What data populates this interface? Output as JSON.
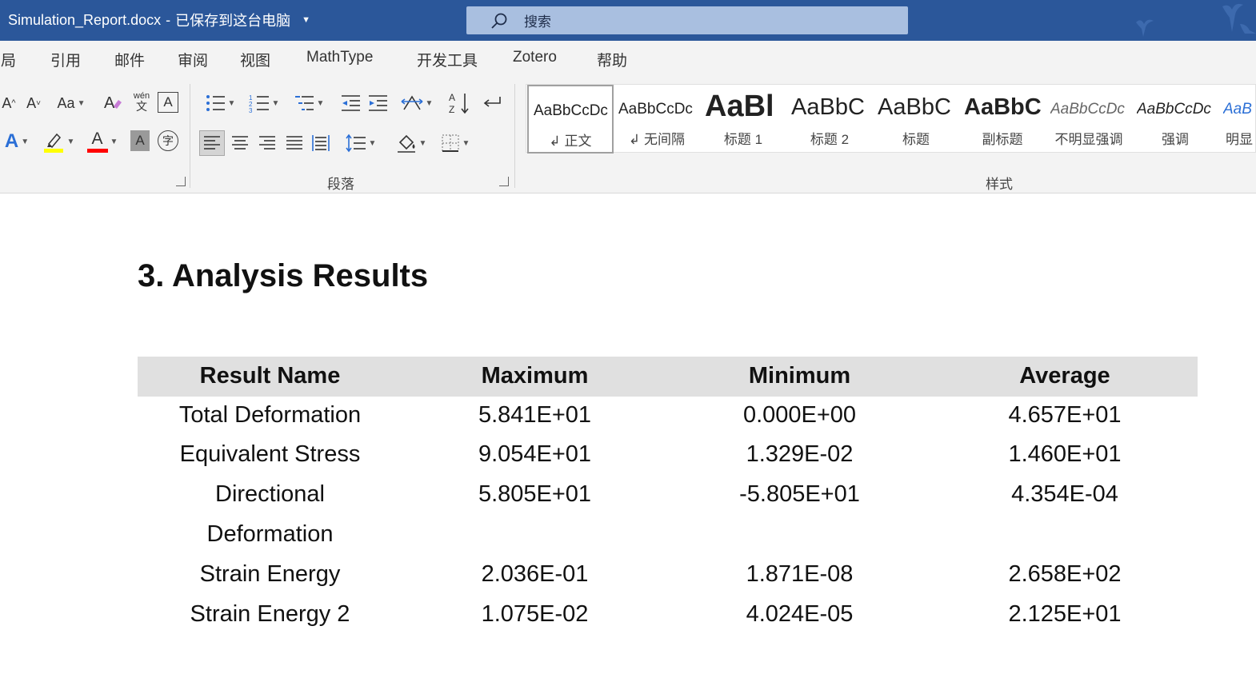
{
  "titlebar": {
    "document_name": "Simulation_Report.docx",
    "separator": "-",
    "save_status": "已保存到这台电脑",
    "search_placeholder": "搜索"
  },
  "menu": {
    "tabs": [
      "布局",
      "引用",
      "邮件",
      "审阅",
      "视图",
      "MathType",
      "开发工具",
      "Zotero",
      "帮助"
    ]
  },
  "ribbon": {
    "paragraph_group_label": "段落",
    "styles_group_label": "样式",
    "styles": [
      {
        "sample": "AaBbCcDc",
        "name": "↲ 正文"
      },
      {
        "sample": "AaBbCcDc",
        "name": "↲ 无间隔"
      },
      {
        "sample": "AaBl",
        "name": "标题 1"
      },
      {
        "sample": "AaBbC",
        "name": "标题 2"
      },
      {
        "sample": "AaBbC",
        "name": "标题"
      },
      {
        "sample": "AaBbC",
        "name": "副标题"
      },
      {
        "sample": "AaBbCcDc",
        "name": "不明显强调"
      },
      {
        "sample": "AaBbCcDc",
        "name": "强调"
      },
      {
        "sample": "AaB",
        "name": "明显"
      }
    ],
    "font_buttons": {
      "change_case": "Aa",
      "phonetic_top": "wén",
      "phonetic_bottom": "文",
      "char_border": "A",
      "text_effect": "A",
      "font_color": "A",
      "char_shading": "A",
      "enclose": "字"
    },
    "colors": {
      "highlight": "#ffff00",
      "font_color": "#ff0000",
      "accent": "#2b579a"
    }
  },
  "document": {
    "heading": "3. Analysis Results",
    "table": {
      "headers": [
        "Result Name",
        "Maximum",
        "Minimum",
        "Average"
      ],
      "rows": [
        {
          "name": [
            "Total Deformation"
          ],
          "max": "5.841E+01",
          "min": "0.000E+00",
          "avg": "4.657E+01"
        },
        {
          "name": [
            "Equivalent Stress"
          ],
          "max": "9.054E+01",
          "min": "1.329E-02",
          "avg": "1.460E+01"
        },
        {
          "name": [
            "Directional",
            "Deformation"
          ],
          "max": "5.805E+01",
          "min": "-5.805E+01",
          "avg": "4.354E-04"
        },
        {
          "name": [
            "Strain Energy"
          ],
          "max": "2.036E-01",
          "min": "1.871E-08",
          "avg": "2.658E+02"
        },
        {
          "name": [
            "Strain Energy 2"
          ],
          "max": "1.075E-02",
          "min": "4.024E-05",
          "avg": "2.125E+01"
        }
      ]
    }
  }
}
